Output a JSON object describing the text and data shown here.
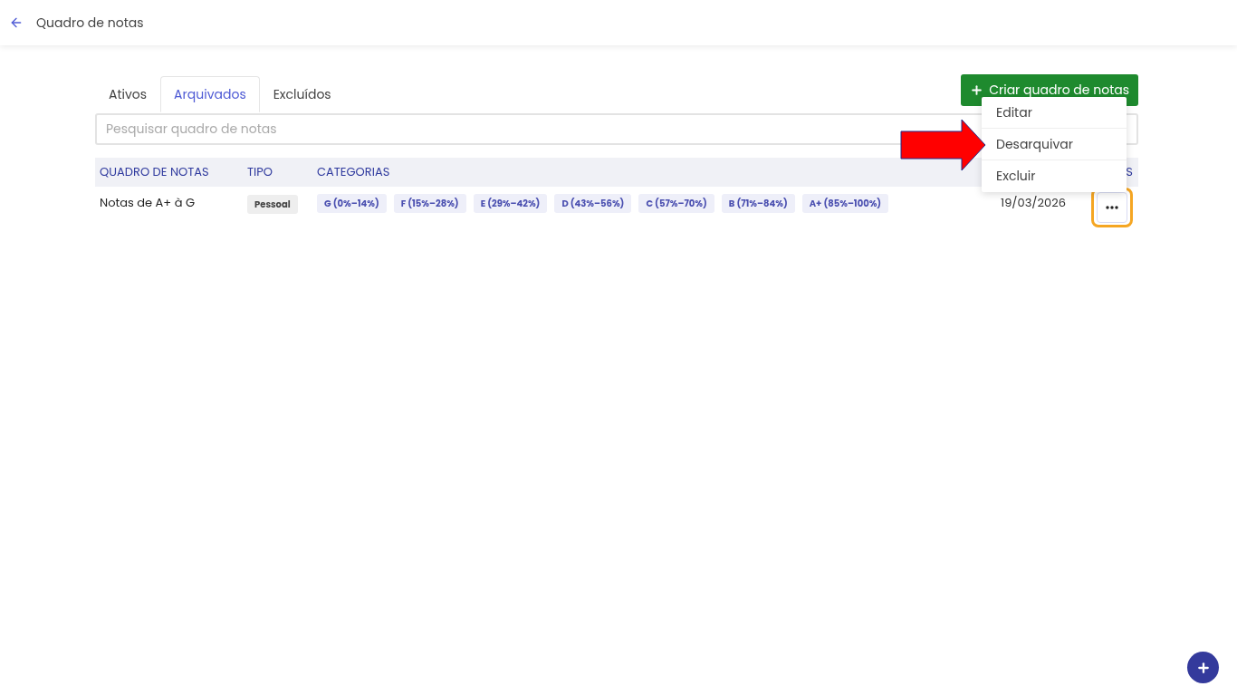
{
  "header": {
    "title": "Quadro de notas"
  },
  "tabs": [
    {
      "label": "Ativos",
      "selected": false
    },
    {
      "label": "Arquivados",
      "selected": true
    },
    {
      "label": "Excluídos",
      "selected": false
    }
  ],
  "create_button": {
    "label": "Criar quadro de notas"
  },
  "search": {
    "placeholder": "Pesquisar quadro de notas"
  },
  "table": {
    "columns": [
      "QUADRO DE NOTAS",
      "TIPO",
      "CATEGORIAS",
      "S"
    ],
    "rows": [
      {
        "name": "Notas de A+ à G",
        "type": "Pessoal",
        "categories": [
          "G (0%–14%)",
          "F (15%–28%)",
          "E (29%–42%)",
          "D (43%–56%)",
          "C (57%–70%)",
          "B (71%–84%)",
          "A+ (85%–100%)"
        ],
        "date": "19/03/2026",
        "menu_open": true
      }
    ]
  },
  "menu": {
    "items": [
      "Editar",
      "Desarquivar",
      "Excluir"
    ]
  }
}
